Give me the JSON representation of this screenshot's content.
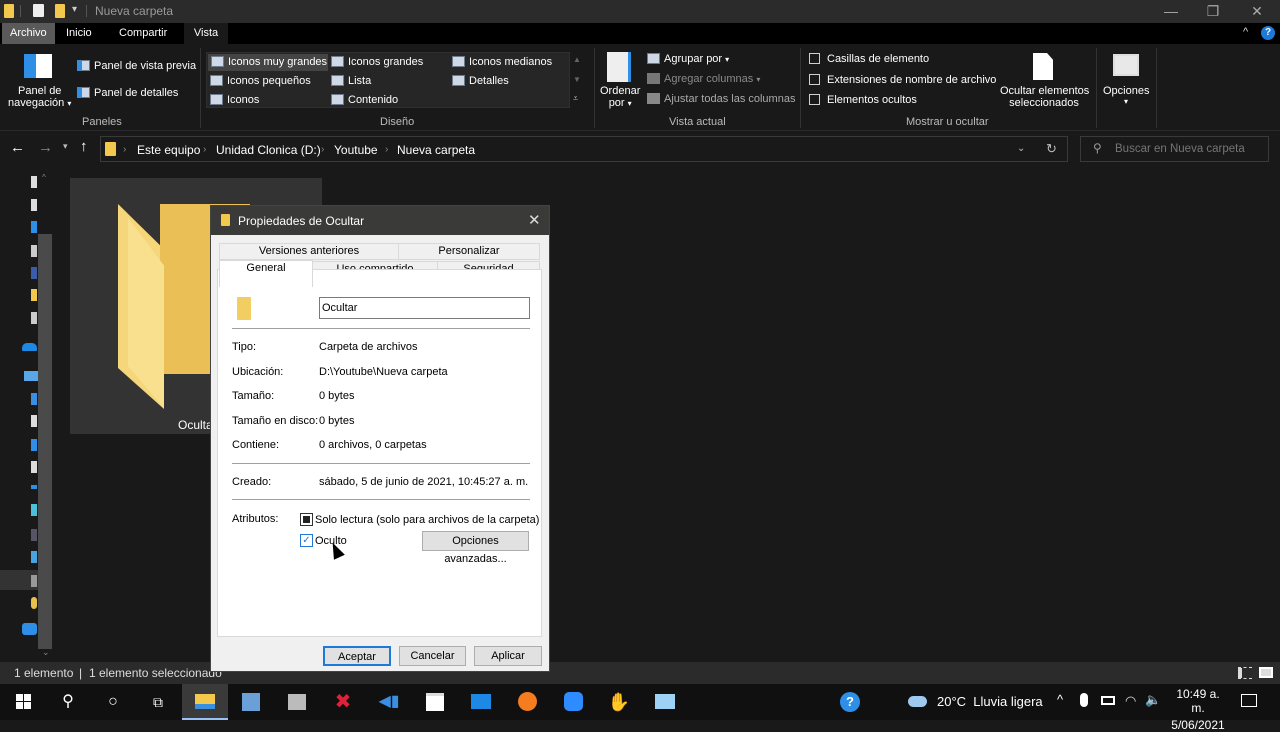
{
  "window": {
    "title": "Nueva carpeta",
    "controls": {
      "minimize": "—",
      "maximize": "❐",
      "close": "✕"
    }
  },
  "ribbon_tabs": [
    {
      "label": "Archivo"
    },
    {
      "label": "Inicio"
    },
    {
      "label": "Compartir"
    },
    {
      "label": "Vista",
      "selected": true
    }
  ],
  "ribbon": {
    "paneles": {
      "group_label": "Paneles",
      "nav_pane": "Panel de",
      "nav_pane_2": "navegación",
      "preview_pane": "Panel de vista previa",
      "details_pane": "Panel de detalles"
    },
    "diseno": {
      "group_label": "Diseño",
      "items": [
        "Iconos muy grandes",
        "Iconos grandes",
        "Iconos medianos",
        "Iconos pequeños",
        "Lista",
        "Detalles",
        "Iconos",
        "Contenido"
      ],
      "selected": "Iconos muy grandes"
    },
    "vista_actual": {
      "group_label": "Vista actual",
      "sort_by": "Ordenar",
      "sort_by_2": "por",
      "group_by": "Agrupar por",
      "add_columns": "Agregar columnas",
      "fit_columns": "Ajustar todas las columnas"
    },
    "mostrar": {
      "group_label": "Mostrar u ocultar",
      "item_checkboxes": {
        "label": "Casillas de elemento",
        "checked": false
      },
      "file_extensions": {
        "label": "Extensiones de nombre de archivo",
        "checked": false
      },
      "hidden_items": {
        "label": "Elementos ocultos",
        "checked": false
      },
      "hide_selected": "Ocultar elementos",
      "hide_selected_2": "seleccionados"
    },
    "options": "Opciones"
  },
  "address": {
    "breadcrumbs": [
      "Este equipo",
      "Unidad Clonica (D:)",
      "Youtube",
      "Nueva carpeta"
    ],
    "search_placeholder": "Buscar en Nueva carpeta"
  },
  "content": {
    "items": [
      {
        "name": "Ocultar",
        "type": "folder",
        "selected": true
      }
    ]
  },
  "status": {
    "count": "1 elemento",
    "selected": "1 elemento seleccionado"
  },
  "dialog": {
    "title": "Propiedades de Ocultar",
    "tabs_row1": [
      "Versiones anteriores",
      "Personalizar"
    ],
    "tabs_row2": [
      "General",
      "Uso compartido",
      "Seguridad"
    ],
    "active_tab": "General",
    "name_value": "Ocultar",
    "props": [
      {
        "label": "Tipo:",
        "value": "Carpeta de archivos"
      },
      {
        "label": "Ubicación:",
        "value": "D:\\Youtube\\Nueva carpeta"
      },
      {
        "label": "Tamaño:",
        "value": "0 bytes"
      },
      {
        "label": "Tamaño en disco:",
        "value": "0 bytes"
      },
      {
        "label": "Contiene:",
        "value": "0 archivos, 0 carpetas"
      }
    ],
    "created_label": "Creado:",
    "created_value": "sábado, 5 de junio de 2021, 10:45:27 a. m.",
    "attributes_label": "Atributos:",
    "readonly": {
      "label": "Solo lectura (solo para archivos de la carpeta)",
      "state": "indeterminate"
    },
    "hidden": {
      "label": "Oculto",
      "checked": true
    },
    "advanced_button": "Opciones avanzadas...",
    "ok": "Aceptar",
    "cancel": "Cancelar",
    "apply": "Aplicar"
  },
  "taskbar": {
    "weather": "20°C  Lluvia ligera",
    "time": "10:49 a. m.",
    "date": "5/06/2021"
  }
}
